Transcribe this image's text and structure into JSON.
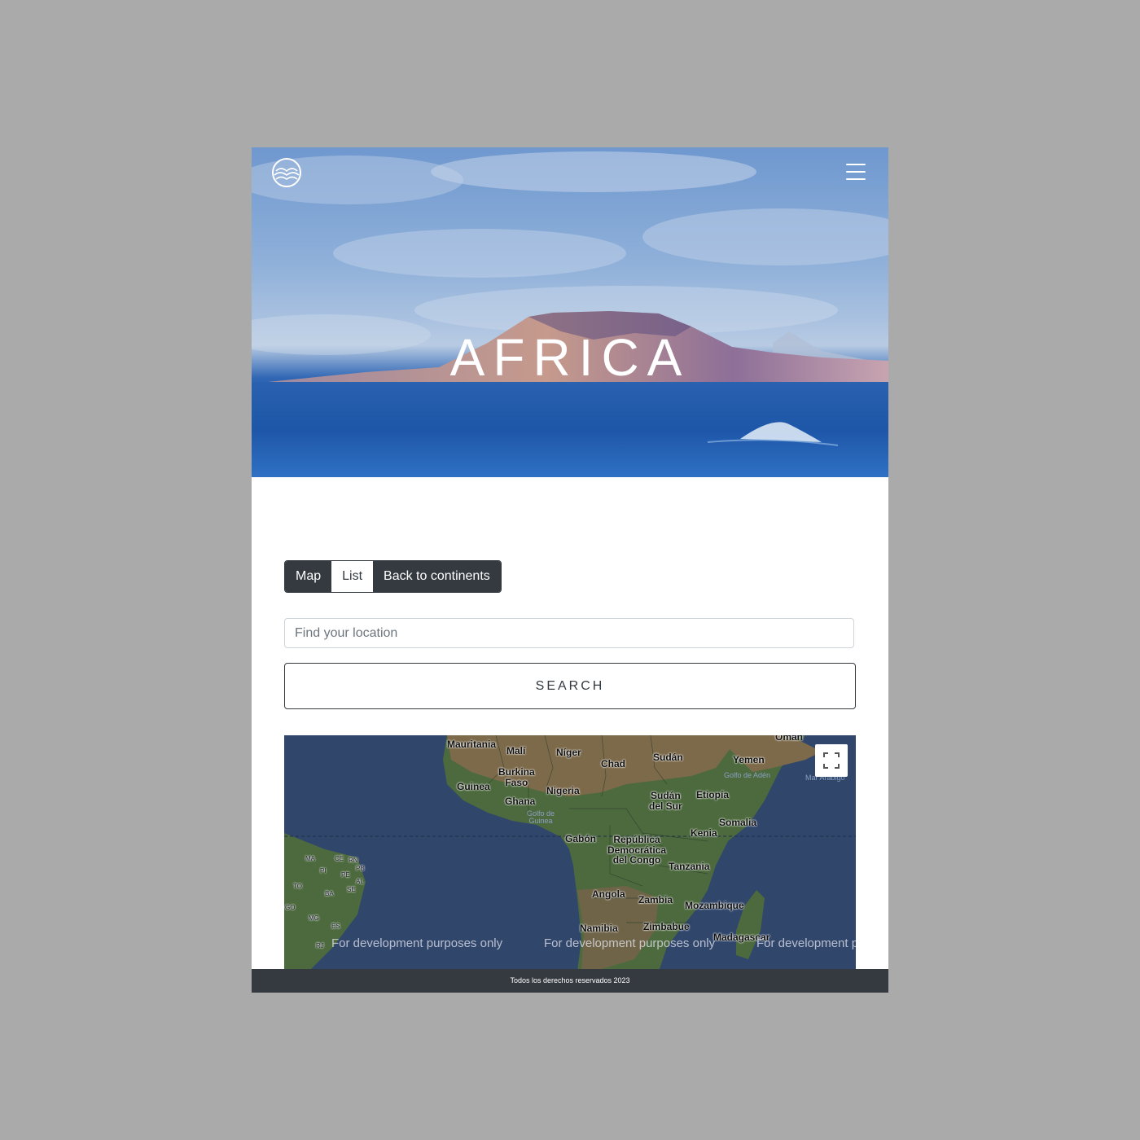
{
  "hero": {
    "title": "AFRICA",
    "logo_icon": "waves-circle-logo-icon",
    "menu_icon": "hamburger-menu-icon"
  },
  "view_toggle": {
    "map_label": "Map",
    "list_label": "List",
    "back_label": "Back to continents"
  },
  "search": {
    "placeholder": "Find your location",
    "button_label": "SEARCH"
  },
  "map": {
    "fullscreen_icon": "fullscreen-icon",
    "watermark": "For development purposes only",
    "countries": {
      "oman": "Omán",
      "mauritania": "Mauritania",
      "mali": "Malí",
      "niger": "Níger",
      "chad": "Chad",
      "sudan": "Sudán",
      "yemen": "Yemen",
      "burkina_line1": "Burkina",
      "burkina_line2": "Faso",
      "guinea": "Guinea",
      "nigeria": "Nigeria",
      "south_sudan_line1": "Sudán",
      "south_sudan_line2": "del Sur",
      "ethiopia": "Etiopía",
      "ghana": "Ghana",
      "somalia": "Somalia",
      "kenya": "Kenia",
      "gabon": "Gabón",
      "drc_line1": "República",
      "drc_line2": "Democrática",
      "drc_line3": "del Congo",
      "tanzania": "Tanzania",
      "angola": "Angola",
      "zambia": "Zambia",
      "mozambique": "Mozambique",
      "namibia": "Namibia",
      "zimbabwe": "Zimbabue",
      "madagascar": "Madagascar"
    },
    "water": {
      "gulf_aden": "Golfo de Adén",
      "arabian_sea": "Mar Arábigo",
      "gulf_guinea_line1": "Golfo de",
      "gulf_guinea_line2": "Guinea"
    },
    "brazil_states": {
      "ma": "MA",
      "ce": "CE",
      "rn": "RN",
      "pi": "PI",
      "pb": "PB",
      "pe": "PE",
      "al": "AL",
      "to": "TO",
      "ba": "BA",
      "se": "SE",
      "go": "GO",
      "mg": "MG",
      "es": "ES",
      "rj": "RJ"
    }
  },
  "footer": {
    "copyright": "Todos los derechos reservados 2023"
  },
  "colors": {
    "dark": "#343a40",
    "ocean": "#30466b",
    "land": "#4d6a3e",
    "desert": "#7d6a4a",
    "background": "#aaaaaa"
  }
}
